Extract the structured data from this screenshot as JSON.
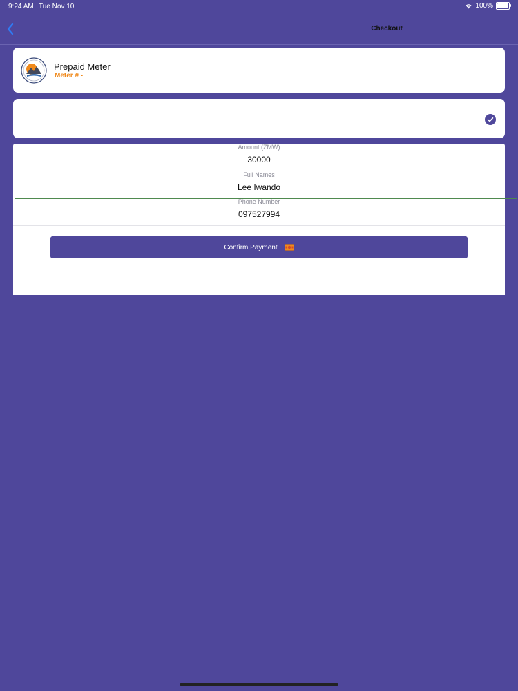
{
  "status_bar": {
    "time": "9:24 AM",
    "date": "Tue Nov 10",
    "battery": "100%",
    "wifi_icon": "wifi-icon",
    "battery_icon": "battery-icon"
  },
  "nav": {
    "title": "Checkout",
    "back_icon": "chevron-left-icon",
    "back_color": "#2f7cf6"
  },
  "meter_card": {
    "title": "Prepaid Meter",
    "meter_number": "Meter # -",
    "logo_icon": "utility-logo-icon",
    "accent_color": "#f08a1c"
  },
  "selection_card": {
    "check_icon": "checkmark-circle-icon"
  },
  "form": {
    "amount": {
      "label": "Amount (ZMW)",
      "value": "30000"
    },
    "full_names": {
      "label": "Full Names",
      "value": "Lee Iwando"
    },
    "phone": {
      "label": "Phone Number",
      "value": "097527994"
    },
    "confirm_label": "Confirm Payment",
    "confirm_icon": "cash-icon"
  },
  "colors": {
    "background": "#4f479b",
    "primary": "#4f479b",
    "card": "#ffffff"
  }
}
